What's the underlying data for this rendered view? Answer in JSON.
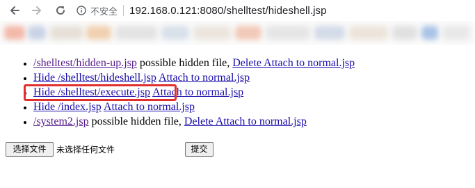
{
  "browser": {
    "security_label": "不安全",
    "url": "192.168.0.121:8080/shelltest/hideshell.jsp"
  },
  "files": [
    {
      "parts": [
        {
          "text": "/shelltest/hidden-up.jsp",
          "type": "link",
          "visited": true,
          "name": "file-link-hidden-up"
        },
        {
          "text": " possible hidden file, ",
          "type": "text"
        },
        {
          "text": "Delete Attach to normal.jsp",
          "type": "link",
          "visited": false,
          "name": "delete-attach-link"
        }
      ]
    },
    {
      "parts": [
        {
          "text": "Hide /shelltest/hideshell.jsp",
          "type": "link",
          "visited": false,
          "name": "hide-link-hideshell"
        },
        {
          "text": " ",
          "type": "text"
        },
        {
          "text": "Attach to normal.jsp",
          "type": "link",
          "visited": false,
          "name": "attach-link"
        }
      ]
    },
    {
      "parts": [
        {
          "text": "Hide /shelltest/execute.jsp",
          "type": "link",
          "visited": false,
          "name": "hide-link-execute"
        },
        {
          "text": " ",
          "type": "text"
        },
        {
          "text": "Attach to normal.jsp",
          "type": "link",
          "visited": false,
          "name": "attach-link"
        }
      ]
    },
    {
      "parts": [
        {
          "text": "Hide /index.jsp",
          "type": "link",
          "visited": false,
          "name": "hide-link-index"
        },
        {
          "text": " ",
          "type": "text"
        },
        {
          "text": "Attach to normal.jsp",
          "type": "link",
          "visited": false,
          "name": "attach-link"
        }
      ]
    },
    {
      "parts": [
        {
          "text": "/system2.jsp",
          "type": "link",
          "visited": true,
          "name": "file-link-system2"
        },
        {
          "text": " possible hidden file, ",
          "type": "text"
        },
        {
          "text": "Delete Attach to normal.jsp",
          "type": "link",
          "visited": false,
          "name": "delete-attach-link"
        }
      ]
    }
  ],
  "form": {
    "choose_file_label": "选择文件",
    "no_file_label": "未选择任何文件",
    "submit_label": "提交"
  },
  "colors": {
    "link": "#1a0dab",
    "visited_link": "#551a8b",
    "highlight_box": "#e1302c"
  },
  "icons": [
    "back-arrow-icon",
    "forward-arrow-icon",
    "reload-icon",
    "info-icon"
  ]
}
